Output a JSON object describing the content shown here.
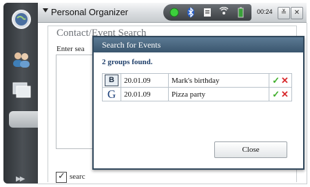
{
  "window": {
    "title": "Personal Organizer",
    "clock": "00:24"
  },
  "sidebar": {
    "icons": [
      "globe-icon",
      "contacts-icon",
      "windows-icon"
    ]
  },
  "status_icons": [
    "green-dot-icon",
    "bluetooth-icon",
    "document-icon",
    "wireless-icon",
    "battery-icon"
  ],
  "background_screen": {
    "title": "Contact/Event Search",
    "prompt": "Enter sea",
    "checkbox_label": "searc"
  },
  "dialog": {
    "title": "Search for Events",
    "result_count": "2 groups found.",
    "results": [
      {
        "icon_letter": "B",
        "date": "20.01.09",
        "name": "Mark's birthday"
      },
      {
        "icon_letter": "G",
        "date": "20.01.09",
        "name": "Pizza party"
      }
    ],
    "close_label": "Close"
  },
  "colors": {
    "dialog_title_bg": "#3a566e",
    "accept": "#3fae2a",
    "reject": "#d8282b"
  }
}
